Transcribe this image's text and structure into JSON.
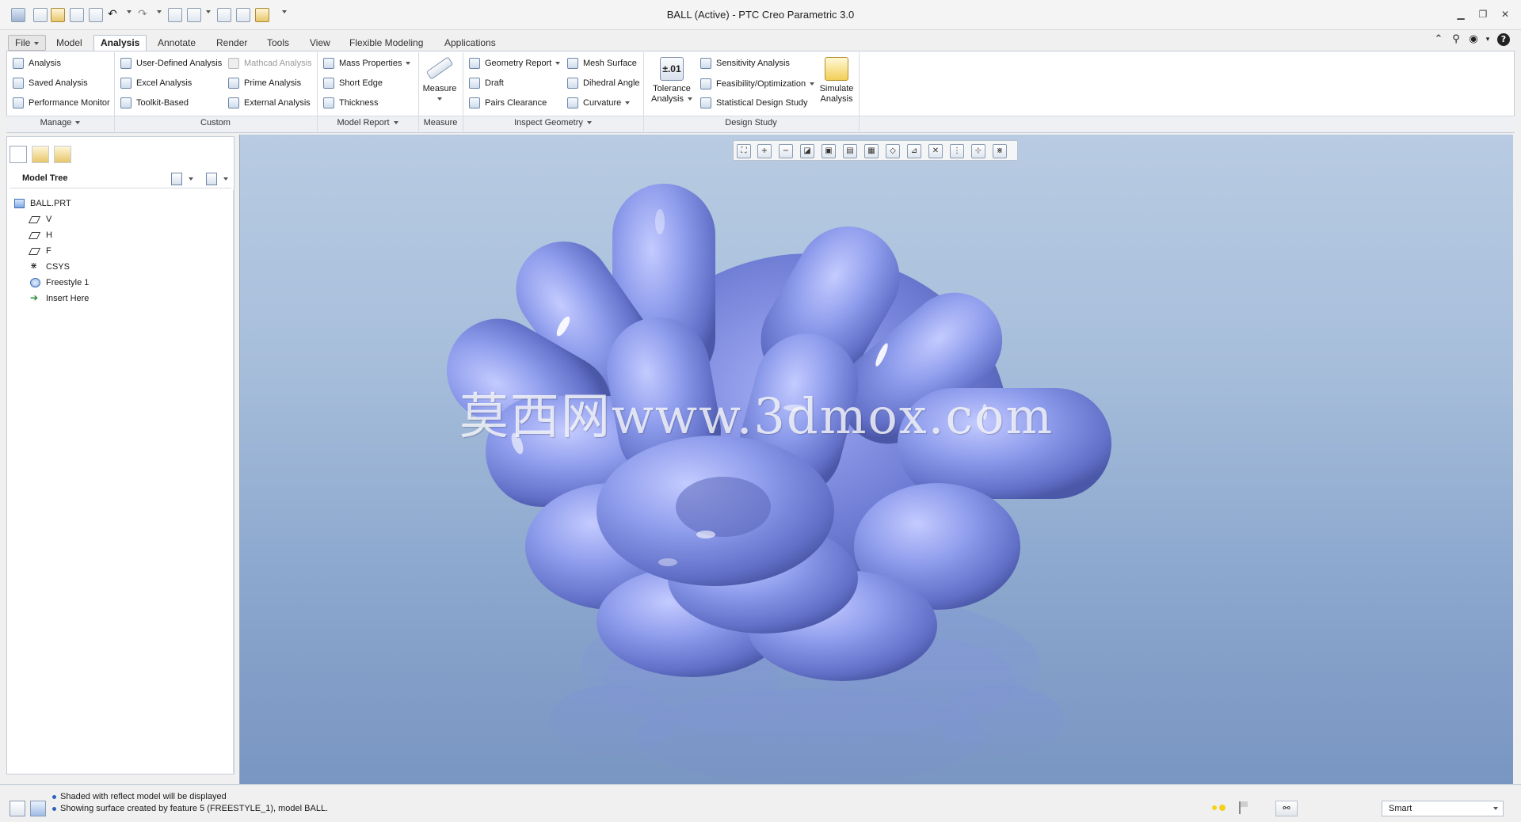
{
  "window": {
    "title": "BALL (Active) - PTC Creo Parametric 3.0"
  },
  "quick_access": [
    "new-icon",
    "open-icon",
    "save-icon",
    "regenerate-icon",
    "undo-icon",
    "redo-icon",
    "window-icon",
    "close-window-icon",
    "select-icon",
    "appearance-icon",
    "customize-icon"
  ],
  "tabs": [
    {
      "label": "File",
      "kind": "file"
    },
    {
      "label": "Model"
    },
    {
      "label": "Analysis",
      "active": true
    },
    {
      "label": "Annotate"
    },
    {
      "label": "Render"
    },
    {
      "label": "Tools"
    },
    {
      "label": "View"
    },
    {
      "label": "Flexible Modeling"
    },
    {
      "label": "Applications"
    }
  ],
  "ribbon": {
    "manage": {
      "group_label": "Manage",
      "items": [
        "Analysis",
        "Saved Analysis",
        "Performance Monitor"
      ]
    },
    "custom": {
      "group_label": "Custom",
      "items": [
        "User-Defined Analysis",
        "Excel Analysis",
        "Toolkit-Based",
        "Mathcad Analysis",
        "Prime Analysis",
        "External Analysis"
      ]
    },
    "model_report": {
      "group_label": "Model Report",
      "items": [
        "Mass Properties",
        "Short Edge",
        "Thickness"
      ]
    },
    "measure": {
      "group_label": "Measure",
      "button": "Measure"
    },
    "inspect_geometry": {
      "group_label": "Inspect Geometry",
      "items": [
        "Geometry Report",
        "Draft",
        "Pairs Clearance",
        "Mesh Surface",
        "Dihedral Angle",
        "Curvature"
      ]
    },
    "design_study": {
      "group_label": "Design Study",
      "tolerance_symbol": "±.01",
      "tolerance_line1": "Tolerance",
      "tolerance_line2": "Analysis",
      "items": [
        "Sensitivity Analysis",
        "Feasibility/Optimization",
        "Statistical Design Study"
      ],
      "simulate_line1": "Simulate",
      "simulate_line2": "Analysis"
    }
  },
  "model_tree": {
    "title": "Model Tree",
    "items": [
      {
        "label": "BALL.PRT",
        "icon": "part-icon"
      },
      {
        "label": "V",
        "icon": "datum-plane-icon"
      },
      {
        "label": "H",
        "icon": "datum-plane-icon"
      },
      {
        "label": "F",
        "icon": "datum-plane-icon"
      },
      {
        "label": "CSYS",
        "icon": "csys-icon"
      },
      {
        "label": "Freestyle 1",
        "icon": "freestyle-icon"
      },
      {
        "label": "Insert Here",
        "icon": "insert-arrow-icon"
      }
    ]
  },
  "view_toolbar": [
    "refit-icon",
    "zoom-in-icon",
    "zoom-out-icon",
    "repaint-icon",
    "display-style-icon",
    "saved-views-icon",
    "view-manager-icon",
    "perspective-icon",
    "datum-display-icon",
    "plane-display-icon",
    "axis-display-icon",
    "point-display-icon",
    "csys-display-icon"
  ],
  "watermark": "莫西网www.3dmox.com",
  "status": {
    "messages": [
      "Shaded with reflect model will be displayed",
      "Showing surface created by feature 5 (FREESTYLE_1), model BALL."
    ],
    "filter_value": "Smart"
  },
  "colors": {
    "accent": "#2c63b8",
    "model_blue": "#7f8fdf",
    "viewport_top": "#b8cbe2",
    "viewport_bottom": "#7995c2"
  }
}
